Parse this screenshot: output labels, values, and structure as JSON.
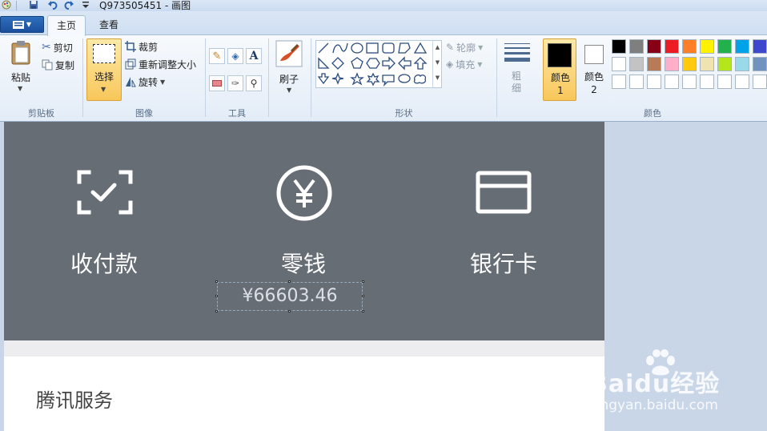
{
  "window": {
    "title": "Q973505451 - 画图"
  },
  "tabs": [
    {
      "label": "主页"
    },
    {
      "label": "查看"
    }
  ],
  "ribbon": {
    "clipboard": {
      "paste": "粘贴",
      "cut": "剪切",
      "copy": "复制",
      "group_label": "剪贴板"
    },
    "image": {
      "select": "选择",
      "crop": "裁剪",
      "resize": "重新调整大小",
      "rotate": "旋转",
      "group_label": "图像"
    },
    "tools": {
      "group_label": "工具"
    },
    "brushes": {
      "label": "刷子"
    },
    "shapes": {
      "outline": "轮廓",
      "fill": "填充",
      "group_label": "形状"
    },
    "size": {
      "label": "粗细"
    },
    "colors": {
      "color1_label": "颜色 1",
      "color2_label": "颜色 2",
      "group_label": "颜色",
      "color1": "#000000",
      "color2": "#ffffff",
      "palette_row1": [
        "#000000",
        "#7f7f7f",
        "#880015",
        "#ed1c24",
        "#ff7f27",
        "#fff200",
        "#22b14c",
        "#00a2e8",
        "#3f48cc"
      ],
      "palette_row2": [
        "#ffffff",
        "#c3c3c3",
        "#b97a57",
        "#ffaec9",
        "#ffc90e",
        "#efe4b0",
        "#b5e61d",
        "#99d9ea",
        "#7092be"
      ],
      "palette_row3": [
        "#ffffff",
        "#ffffff",
        "#ffffff",
        "#ffffff",
        "#ffffff",
        "#ffffff",
        "#ffffff",
        "#ffffff",
        "#ffffff"
      ]
    }
  },
  "image": {
    "actions": [
      {
        "label": "收付款",
        "icon": "scan-check-icon"
      },
      {
        "label": "零钱",
        "icon": "yen-coin-icon"
      },
      {
        "label": "银行卡",
        "icon": "bank-card-icon"
      }
    ],
    "balance": "¥66603.46",
    "section_title": "腾讯服务"
  },
  "watermark": {
    "brand": "Baidu经验",
    "url": "jingyan.baidu.com"
  }
}
